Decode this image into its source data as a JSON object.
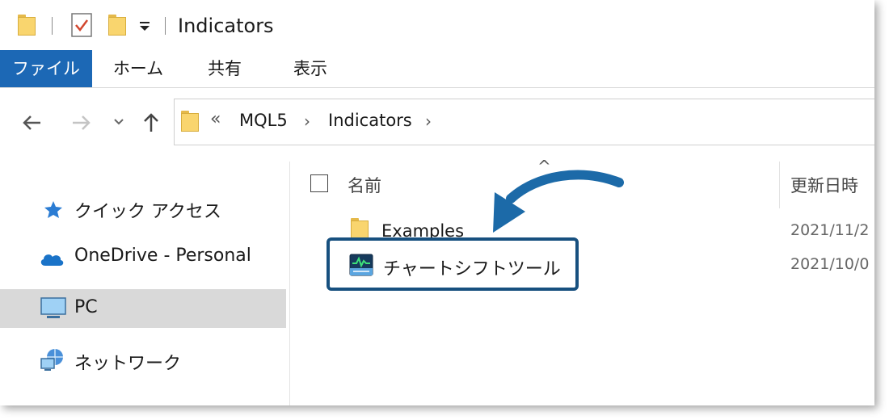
{
  "window": {
    "title": "Indicators"
  },
  "ribbon": {
    "tabs": [
      "ファイル",
      "ホーム",
      "共有",
      "表示"
    ],
    "active_index": 0,
    "active_color": "#1c68b5"
  },
  "address": {
    "overflow": "«",
    "crumbs": [
      "MQL5",
      "Indicators"
    ]
  },
  "nav_pane": {
    "items": [
      {
        "label": "クイック アクセス",
        "icon": "star-icon"
      },
      {
        "label": "OneDrive - Personal",
        "icon": "cloud-icon"
      },
      {
        "label": "PC",
        "icon": "monitor-icon",
        "selected": true
      },
      {
        "label": "ネットワーク",
        "icon": "network-icon"
      }
    ]
  },
  "file_list": {
    "columns": {
      "name": "名前",
      "date": "更新日時"
    },
    "rows": [
      {
        "name": "Examples",
        "date": "2021/11/2",
        "type": "folder"
      },
      {
        "name": "チャートシフトツール",
        "date": "2021/10/0",
        "type": "indicator",
        "highlighted": true
      }
    ]
  },
  "annotation": {
    "highlight_color": "#17507f",
    "arrow_color": "#1c6aa8"
  }
}
